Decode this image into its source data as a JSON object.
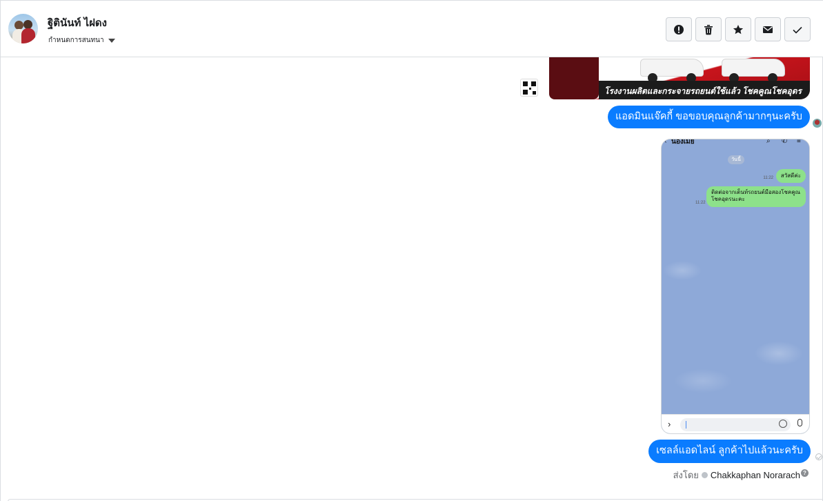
{
  "header": {
    "contact_name": "ฐิตินันท์ ไฝดง",
    "assign_label": "กำหนดการสนทนา",
    "actions": [
      {
        "name": "spam-button",
        "icon": "exclamation-circle-icon"
      },
      {
        "name": "delete-button",
        "icon": "trash-icon"
      },
      {
        "name": "star-button",
        "icon": "star-icon"
      },
      {
        "name": "mark-unread-button",
        "icon": "envelope-icon"
      },
      {
        "name": "mark-done-button",
        "icon": "check-icon"
      }
    ]
  },
  "thread": {
    "banner_caption": "โรงงานผลิตและกระจายรถยนต์ใช้แล้ว โชคคูณโชคอุดร",
    "message_1": "แอดมินแจ๊คกี้ ขอขอบคุณลูกค้ามากๆนะครับ",
    "screenshot": {
      "chat_title": "น้องเมย์",
      "day_chip": "วันนี้",
      "msg_1": "สวัสดีค่ะ",
      "msg_1_time": "11:22",
      "msg_2": "ติดต่อจากเต็นท์รถยนต์มือสองโชคคูณโชคอุดรนะคะ",
      "msg_2_time": "11:22"
    },
    "message_2": "เซลล์แอดไลน์ ลูกค้าไปแล้วนะครับ",
    "sent_by_label": "ส่งโดย",
    "sent_by_name": "Chakkaphan Norarach"
  },
  "colors": {
    "bubble": "#0a7cff",
    "border": "#dadde1",
    "line_chat_bg": "#8ea9d8",
    "line_bubble": "#8de18a"
  }
}
